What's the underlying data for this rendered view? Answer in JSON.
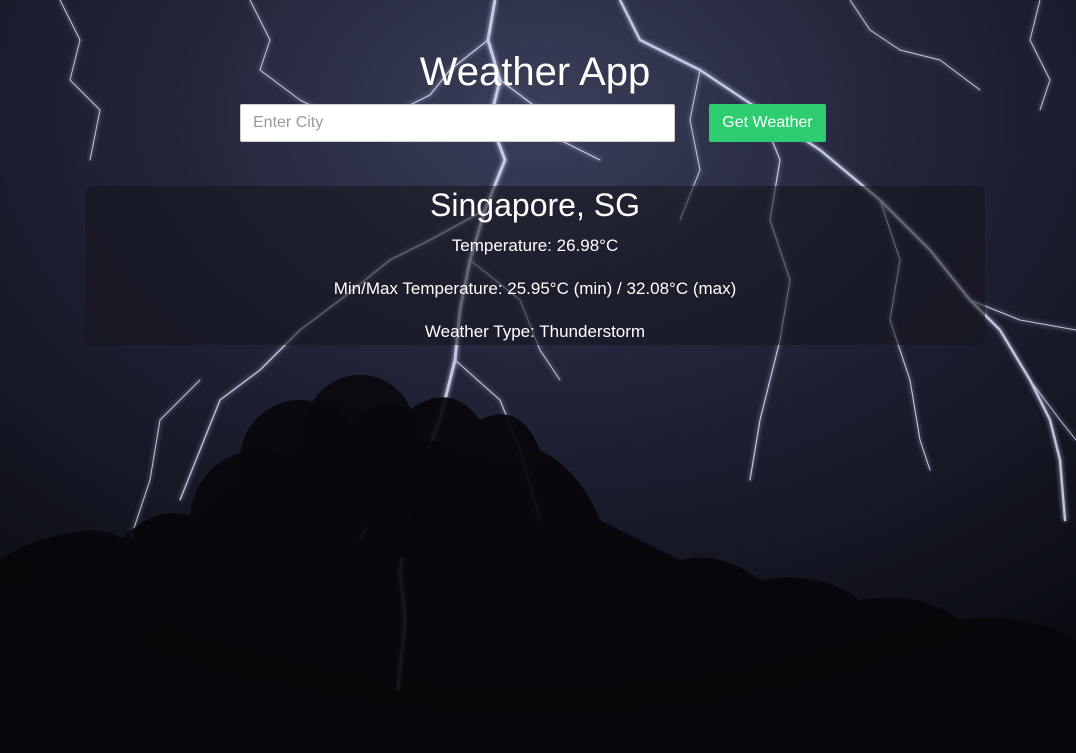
{
  "app": {
    "title": "Weather App"
  },
  "search": {
    "placeholder": "Enter City",
    "value": "",
    "button_label": "Get Weather"
  },
  "result": {
    "city": "Singapore, SG",
    "temperature": "Temperature: 26.98°C",
    "min_max": "Min/Max Temperature: 25.95°C (min) / 32.08°C (max)",
    "weather_type": "Weather Type: Thunderstorm"
  },
  "colors": {
    "button": "#2ecc71",
    "text": "#ffffff"
  }
}
